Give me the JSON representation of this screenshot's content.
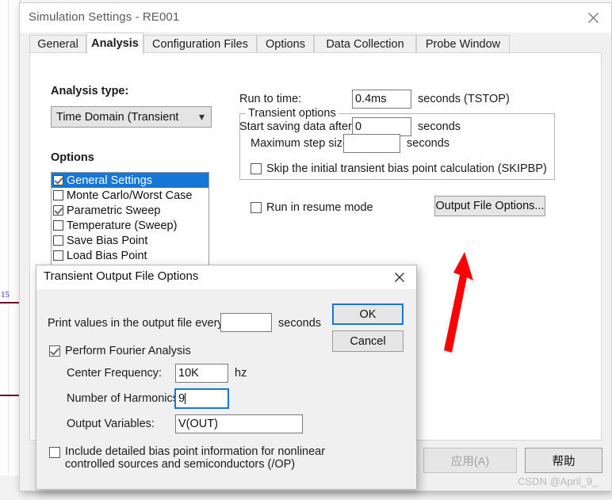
{
  "window": {
    "title": "Simulation Settings - RE001",
    "close_icon": "close-icon"
  },
  "tabs": [
    {
      "label": "General",
      "active": false
    },
    {
      "label": "Analysis",
      "active": true
    },
    {
      "label": "Configuration Files",
      "active": false
    },
    {
      "label": "Options",
      "active": false
    },
    {
      "label": "Data Collection",
      "active": false
    },
    {
      "label": "Probe Window",
      "active": false
    }
  ],
  "analysis": {
    "type_label": "Analysis type:",
    "type_value": "Time Domain (Transient",
    "type_arrow_icon": "chevron-down-icon",
    "options_label": "Options",
    "options": [
      {
        "label": "General Settings",
        "checked": true,
        "selected": true
      },
      {
        "label": "Monte Carlo/Worst Case",
        "checked": false,
        "selected": false
      },
      {
        "label": "Parametric Sweep",
        "checked": true,
        "selected": false
      },
      {
        "label": "Temperature (Sweep)",
        "checked": false,
        "selected": false
      },
      {
        "label": "Save Bias Point",
        "checked": false,
        "selected": false
      },
      {
        "label": "Load Bias Point",
        "checked": false,
        "selected": false
      }
    ],
    "run_to_time_label": "Run to time:",
    "run_to_time_value": "0.4ms",
    "run_to_time_units": "seconds  (TSTOP)",
    "start_saving_label": "Start saving data after:",
    "start_saving_value": "0",
    "start_saving_units": "seconds",
    "transient_group_title": "Transient options",
    "max_step_label": "Maximum step size:",
    "max_step_value": "",
    "max_step_units": "seconds",
    "skipbp_label": "Skip the initial transient bias point calculation  (SKIPBP)",
    "skipbp_checked": false,
    "resume_label": "Run in resume mode",
    "resume_checked": false,
    "output_file_options_button": "Output File Options..."
  },
  "dialog": {
    "title": "Transient Output File Options",
    "close_icon": "close-icon",
    "print_values_label": "Print values in the output file every:",
    "print_values_value": "",
    "print_values_units": "seconds",
    "fourier_label": "Perform Fourier Analysis",
    "fourier_checked": true,
    "center_freq_label": "Center Frequency:",
    "center_freq_value": "10K",
    "center_freq_units": "hz",
    "harmonics_label": "Number of Harmonics:",
    "harmonics_value": "9",
    "output_vars_label": "Output Variables:",
    "output_vars_value": "V(OUT)",
    "bias_checkbox_line1": "Include detailed bias point information for nonlinear",
    "bias_checkbox_line2": "controlled sources and semiconductors (/OP)",
    "bias_checked": false,
    "ok_button": "OK",
    "cancel_button": "Cancel"
  },
  "bottom": {
    "apply_button": "应用(A)",
    "help_button": "帮助"
  },
  "background": {
    "page_number": "15"
  },
  "watermark": "CSDN @April_9_",
  "colors": {
    "selection_blue": "#1677d6",
    "annotation_red": "#fb0104",
    "window_face": "#f0f0f0",
    "field_white": "#ffffff"
  }
}
